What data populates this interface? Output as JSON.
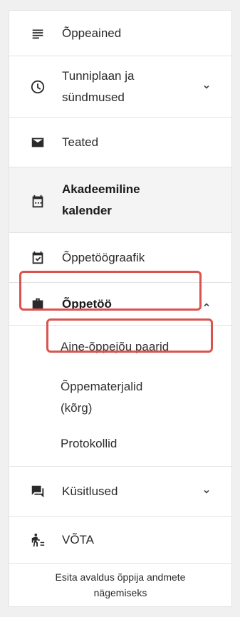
{
  "menu": {
    "oppeained": "Õppeained",
    "tunniplaan_line1": "Tunniplaan ja",
    "tunniplaan_line2": "sündmused",
    "teated": "Teated",
    "akadeemiline_line1": "Akadeemiline",
    "akadeemiline_line2": "kalender",
    "oppetoograafik": "Õppetöögraafik",
    "oppetoo": "Õppetöö",
    "sub_paarid": "Aine-õppejõu paarid",
    "sub_materjalid_line1": "Õppematerjalid",
    "sub_materjalid_line2": "(kõrg)",
    "sub_protokollid": "Protokollid",
    "kusitlused": "Küsitlused",
    "vota": "VÕTA"
  },
  "footer": {
    "line1": "Esita avaldus õppija andmete",
    "line2": "nägemiseks"
  },
  "colors": {
    "highlight": "#d9534f",
    "active_bg": "#f4f4f4"
  }
}
